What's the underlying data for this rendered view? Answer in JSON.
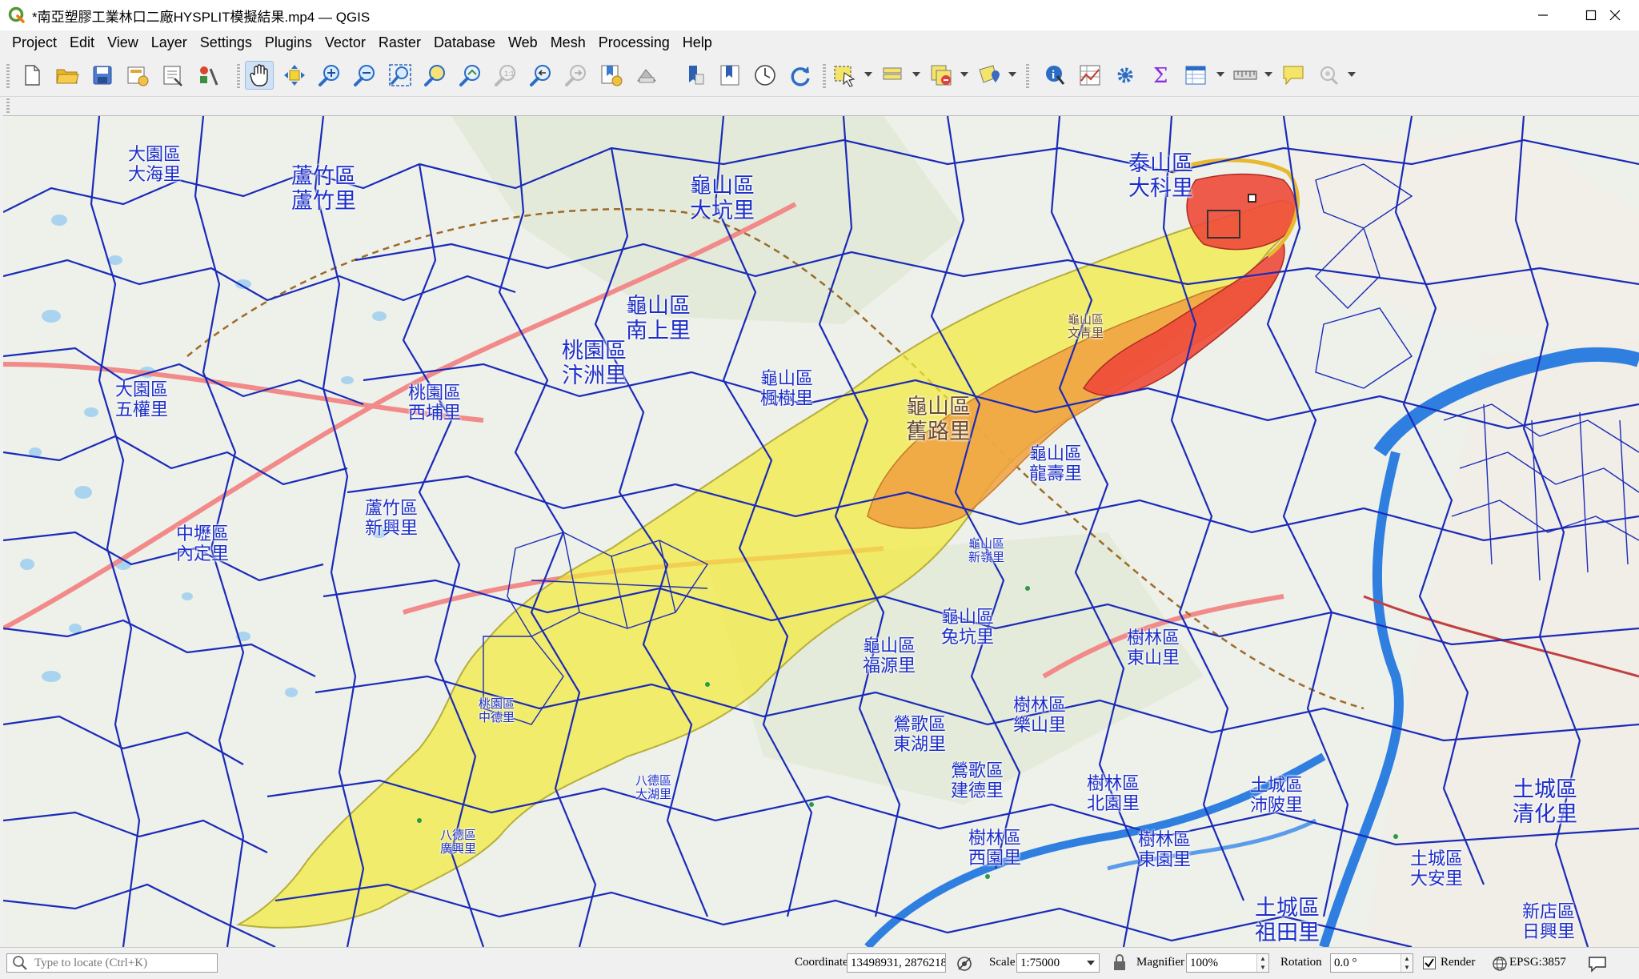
{
  "window": {
    "title": "*南亞塑膠工業林口二廠HYSPLIT模擬結果.mp4 — QGIS",
    "minimize_icon": "minimize-icon",
    "maximize_icon": "maximize-icon",
    "close_icon": "close-icon"
  },
  "menu": [
    "Project",
    "Edit",
    "View",
    "Layer",
    "Settings",
    "Plugins",
    "Vector",
    "Raster",
    "Database",
    "Web",
    "Mesh",
    "Processing",
    "Help"
  ],
  "toolbar": {
    "icons": [
      "new-project-icon",
      "open-project-icon",
      "save-project-icon",
      "save-as-icon",
      "print-layout-icon",
      "style-manager-icon",
      "pan-map-icon",
      "pan-to-selection-icon",
      "zoom-in-icon",
      "zoom-out-icon",
      "zoom-full-icon",
      "zoom-to-selection-icon",
      "zoom-to-layer-icon",
      "zoom-native-icon",
      "zoom-last-icon",
      "zoom-next-icon",
      "new-bookmark-icon",
      "show-bookmarks-icon",
      "map-tips-icon",
      "temporal-controller-icon",
      "refresh-icon",
      "select-features-icon",
      "select-by-value-icon",
      "deselect-icon",
      "select-location-icon",
      "identify-icon",
      "attribute-table-open-icon",
      "processing-toolbox-icon",
      "statistics-sum-icon",
      "open-attribute-table-icon",
      "measure-line-icon",
      "annotation-icon",
      "locator-search-icon"
    ]
  },
  "map": {
    "colors": {
      "boundary": "#1a2bb8",
      "plume_low": "#f2ea3c",
      "plume_mid": "#f0a040",
      "plume_high": "#ee4a3a",
      "river": "#2f7fe0",
      "road": "#f28a8a"
    },
    "labels": {
      "dayuan_dahai": "大園區\n大海里",
      "luzhu_luzhu": "蘆竹區\n蘆竹里",
      "guishan_dakeng": "龜山區\n大坑里",
      "taishan_dake": "泰山區\n大科里",
      "guishan_nanshang": "龜山區\n南上里",
      "taoyuan_wuzhou": "桃園區\n汴洲里",
      "dayuan_wuquan": "大園區\n五權里",
      "guishan_fengshu": "龜山區\n楓樹里",
      "guishan_jiulu": "龜山區\n舊路里",
      "guishan_longshou": "龜山區\n龍壽里",
      "zhongli_neiding": "中壢區\n內定里",
      "guishan_wenqing": "龜山區\n文青里",
      "guishan_tukeng": "龜山區\n兔坑里",
      "shulin_dongshan": "樹林區\n東山里",
      "shulin_leshan": "樹林區\n樂山里",
      "shulin_beiyuan": "樹林區\n北園里",
      "shulin_xiyuan": "樹林區\n西園里",
      "shulin_donglun": "樹林區\n東園里",
      "tucheng_qinghua": "土城區\n清化里",
      "tucheng_zutian": "土城區\n祖田里",
      "tucheng_da_an": "土城區\n大安里",
      "xindian_rixing": "新店區\n日興里",
      "yingge_jiande": "鶯歌區\n建德里",
      "yingge_dongshi": "鶯歌區\n東湖里",
      "bade_dahu": "八德區\n大湖里",
      "taoyuan_zhongde": "桃園區\n中德里",
      "taoyuan_ximen": "桃園區\n西埔里",
      "luzhu_xinxing": "蘆竹區\n新興里",
      "guishan_xinglong": "龜山區\n新嶺里",
      "guishan_fuyuan": "龜山區\n福源里",
      "tucheng_peipo": "土城區\n沛陂里",
      "bade_guangxing": "八德區\n廣興里"
    }
  },
  "status": {
    "locator_placeholder": "Type to locate (Ctrl+K)",
    "coordinate_label": "Coordinate",
    "coordinate_value": "13498931, 2876218",
    "scale_label": "Scale",
    "scale_value": "1:75000",
    "magnifier_label": "Magnifier",
    "magnifier_value": "100%",
    "rotation_label": "Rotation",
    "rotation_value": "0.0 °",
    "render_label": "Render",
    "render_checked": true,
    "crs_value": "EPSG:3857",
    "messages_icon": "messages-icon"
  }
}
